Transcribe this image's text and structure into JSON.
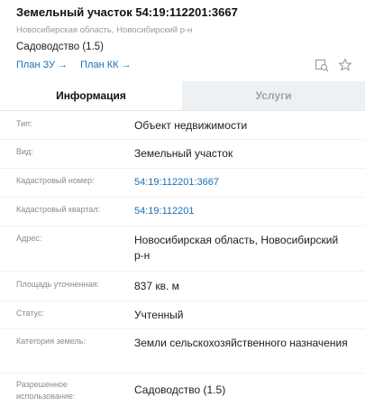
{
  "header": {
    "title": "Земельный участок 54:19:112201:3667",
    "address": "Новосибирская область, Новосибирский р-н",
    "note": "Садоводство (1.5)",
    "links": [
      {
        "label": "План ЗУ →"
      },
      {
        "label": "План КК →"
      }
    ],
    "actions": {
      "search_icon": "map-search-icon",
      "favorite_icon": "star-icon"
    }
  },
  "tabs": [
    {
      "label": "Информация",
      "active": true
    },
    {
      "label": "Услуги",
      "active": false
    }
  ],
  "rows": [
    {
      "label": "Тип:",
      "value": "Объект недвижимости",
      "link": false
    },
    {
      "label": "Вид:",
      "value": "Земельный участок",
      "link": false
    },
    {
      "label": "Кадастровый номер:",
      "value": "54:19:112201:3667",
      "link": true
    },
    {
      "label": "Кадастровый квартал:",
      "value": "54:19:112201",
      "link": true
    },
    {
      "label": "Адрес:",
      "value": "Новосибирская область, Новосибирский р-н",
      "link": false
    },
    {
      "label": "Площадь уточненная:",
      "value": "837 кв. м",
      "link": false
    },
    {
      "label": "Статус:",
      "value": "Учтенный",
      "link": false
    },
    {
      "label": "Категория земель:",
      "value": "Земли сельскохозяйственного назначения",
      "link": false
    },
    {
      "label": "Разрешенное использование:",
      "value": "Садоводство (1.5)",
      "link": false
    }
  ],
  "colors": {
    "link": "#1a6fb5",
    "tab_inactive_bg": "#eef1f4"
  }
}
